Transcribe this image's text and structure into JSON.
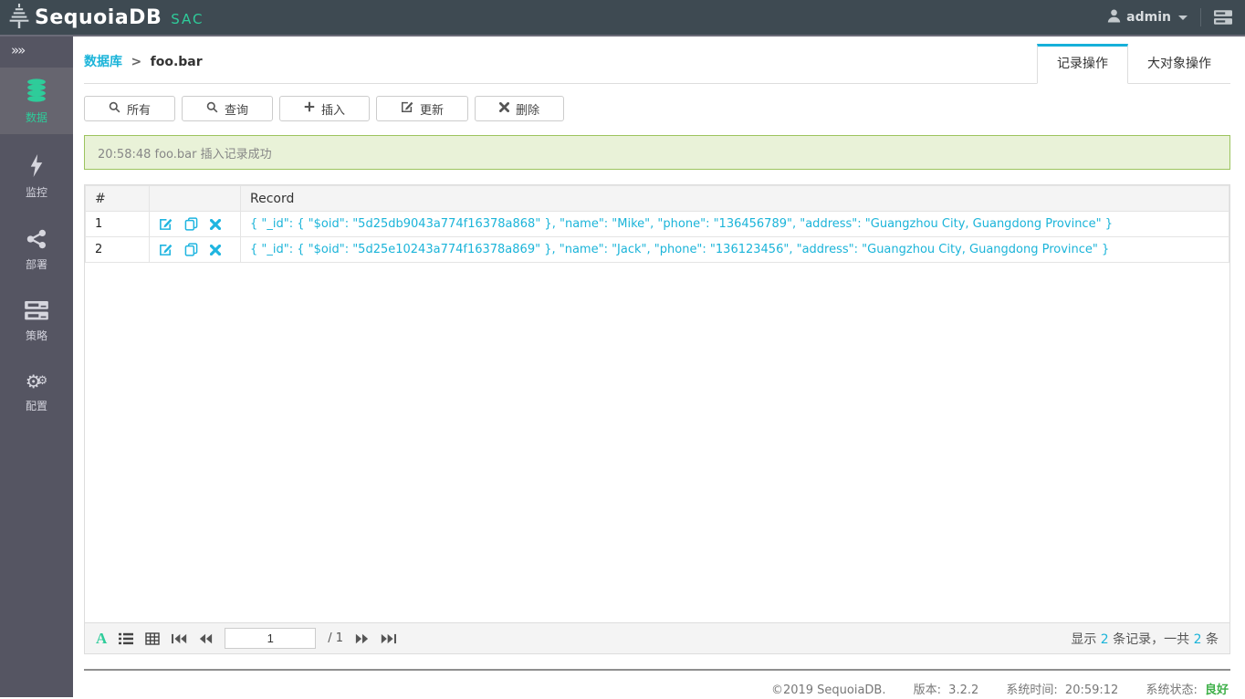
{
  "header": {
    "brand": "SequoiaDB",
    "brand_suffix": "SAC",
    "user": "admin"
  },
  "sidebar": {
    "items": [
      {
        "label": "数据",
        "icon": "database-icon",
        "active": true
      },
      {
        "label": "监控",
        "icon": "lightning-icon",
        "active": false
      },
      {
        "label": "部署",
        "icon": "share-icon",
        "active": false
      },
      {
        "label": "策略",
        "icon": "servers-icon",
        "active": false
      },
      {
        "label": "配置",
        "icon": "gears-icon",
        "active": false
      }
    ]
  },
  "breadcrumb": {
    "parent": "数据库",
    "separator": ">",
    "current": "foo.bar"
  },
  "tabs": [
    {
      "label": "记录操作",
      "active": true
    },
    {
      "label": "大对象操作",
      "active": false
    }
  ],
  "toolbar": {
    "buttons": [
      {
        "label": "所有",
        "icon": "search-icon"
      },
      {
        "label": "查询",
        "icon": "search-icon"
      },
      {
        "label": "插入",
        "icon": "plus-icon"
      },
      {
        "label": "更新",
        "icon": "edit-icon"
      },
      {
        "label": "删除",
        "icon": "x-icon"
      }
    ]
  },
  "alert": {
    "message": "20:58:48 foo.bar 插入记录成功"
  },
  "table": {
    "columns": {
      "index": "#",
      "actions": "",
      "record": "Record"
    },
    "rows": [
      {
        "index": "1",
        "record": "{ \"_id\": { \"$oid\": \"5d25db9043a774f16378a868\" }, \"name\": \"Mike\", \"phone\": \"136456789\", \"address\": \"Guangzhou City, Guangdong Province\" }"
      },
      {
        "index": "2",
        "record": "{ \"_id\": { \"$oid\": \"5d25e10243a774f16378a869\" }, \"name\": \"Jack\", \"phone\": \"136123456\", \"address\": \"Guangzhou City, Guangdong Province\" }"
      }
    ]
  },
  "pagination": {
    "page": "1",
    "total_label": "/ 1",
    "summary": {
      "prefix": "显示 ",
      "count": "2",
      "mid": " 条记录，一共 ",
      "total": "2",
      "suffix": " 条"
    }
  },
  "footer": {
    "copyright": "©2019 SequoiaDB.",
    "version_label": "版本:",
    "version": "3.2.2",
    "time_label": "系统时间:",
    "time": "20:59:12",
    "status_label": "系统状态:",
    "status": "良好"
  },
  "colors": {
    "accent_green": "#2ecc9a",
    "accent_cyan": "#1bb4d9",
    "header_bg": "#3e4a52",
    "sidebar_bg": "#555562",
    "sidebar_active_bg": "#66656f",
    "alert_bg": "#e9f2d8",
    "alert_border": "#9cc45e",
    "status_ok": "#3eb049"
  }
}
